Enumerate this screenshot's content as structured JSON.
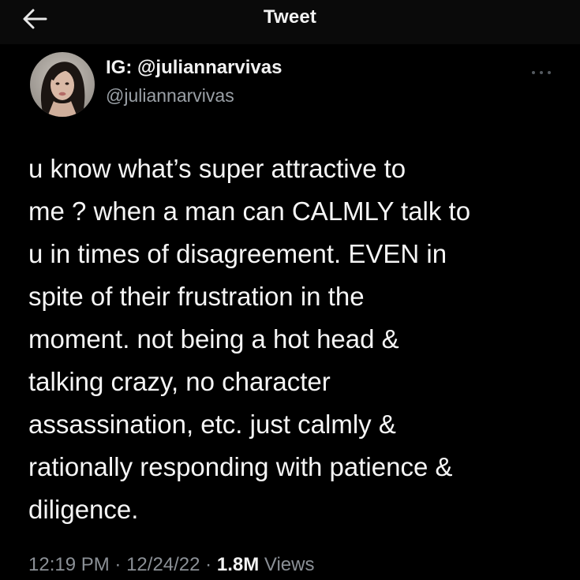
{
  "header": {
    "title": "Tweet",
    "back_icon": "arrow-left-icon"
  },
  "author": {
    "display_name": "IG: @juliannarvivas",
    "handle": "@juliannarvivas",
    "avatar_icon": "profile-photo"
  },
  "more_icon": "more-horizontal-icon",
  "tweet": {
    "text": "u know what’s super attractive to\nme ? when a man can CALMLY talk to\nu in times of disagreement. EVEN in\nspite of their frustration in the\nmoment. not being a hot head &\ntalking crazy, no character\nassassination, etc. just calmly &\nrationally responding with patience &\ndiligence."
  },
  "meta": {
    "time": "12:19 PM",
    "separator": "·",
    "date": "12/24/22",
    "views_count": "1.8M",
    "views_label": "Views"
  },
  "colors": {
    "background": "#000000",
    "topbar": "#0a0a0a",
    "text_primary": "#f5f5f5",
    "text_secondary": "#9aa0a6"
  }
}
